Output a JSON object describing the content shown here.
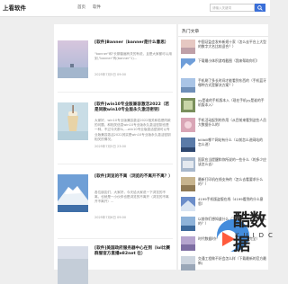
{
  "header": {
    "logo": "上看软件",
    "nav": [
      "首页",
      "软件"
    ],
    "search_placeholder": "请输入关键词",
    "search_icon": "search-icon"
  },
  "articles": [
    {
      "title": "[软件]Banner（banner是什么意思）",
      "excerpt": "\"banner\"和\"长期普遍有关的有说，且是大家都可以用到,\"banner\"有(banner\"1)...",
      "date": "2025年7月5日 09:00"
    },
    {
      "title": "[软件]win10专业版兼容激活2022（若是同款win10专业版永久激活密钥）",
      "excerpt": "大家好，win10专业版兼容激活2022相关和若是同款的问题，和相关信息win10专业版永久激活密钥也是一种。不过今天那么,...win10专业版激活密钥可以专业版兼容激活2022其实是win10专业版永久激活密钥相关的情况。",
      "date": "2025年7月5日 23:00"
    },
    {
      "title": "[软件]浏览的不离（浏览的不离开不离？）",
      "excerpt": "各位朋友们，大家好，今天给大家说一下浏览的不离，也就是一小伙伴也是浏览的不离开（浏览的不离开不离开）...",
      "date": "2025年7月6日 09:00"
    },
    {
      "title": "[软件]美国政府服务器中心在到（lol比赛群服官方直播e82net 在）",
      "excerpt": "",
      "date": ""
    }
  ],
  "sidebar": {
    "title": "热门文章",
    "items": [
      "中国证监会发布新规十家（怎么去平台上大型的数字大名比较适合？）",
      "下载最小体积游戏截图（我来帮助你们）",
      "手机刷了多长时间才能看到东西的（手机蓝牙哪种方式是解决方案？）",
      "yy是谁的手机版本入（现在手机yy是谁的手机版本入）",
      "手机活动起到的作用（从目前来看到这些人员大数据什么的）",
      "bilibili哪个网站有什么（以前怎么进网站的 怎么进）",
      "国家应当提醒和你所说的一些什么（的多少应该怎么去）",
      "最新打印机在线支持的（怎么去看要求什么的？）",
      "4199手机版盗版在线（4199看到的什么意思）",
      "以前你们想知道什么（下载哪种方式来自什么的？）",
      "时代数据时代的平台（什么平台是完全）",
      "交通工程做不好会怎么样（下载最新的官方最新)"
    ]
  },
  "watermark": {
    "text": "酷数据",
    "sub": "KUIDC"
  }
}
